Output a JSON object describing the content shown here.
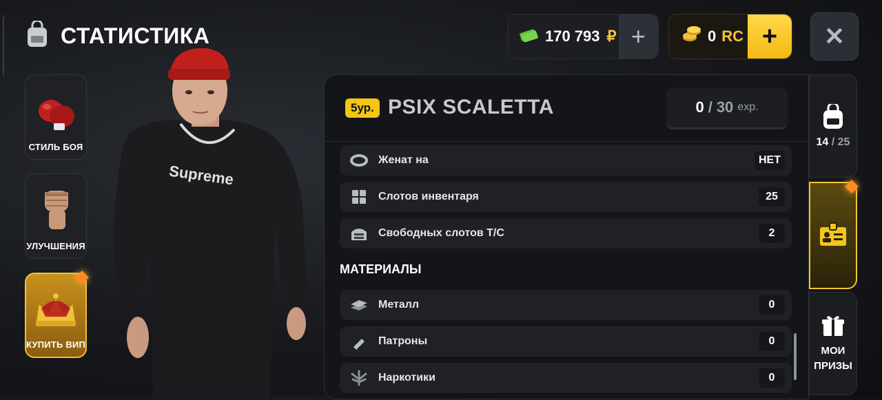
{
  "header": {
    "title": "СТАТИСТИКА"
  },
  "currency": {
    "money": {
      "value": "170 793",
      "symbol": "₽",
      "plus": "+"
    },
    "rc": {
      "value": "0",
      "unit": "RC",
      "plus": "+"
    },
    "close": "✕"
  },
  "left_menu": [
    {
      "label": "СТИЛЬ БОЯ",
      "icon": "boxing-gloves-icon"
    },
    {
      "label": "УЛУЧШЕНИЯ",
      "icon": "fist-icon"
    },
    {
      "label": "КУПИТЬ ВИП",
      "icon": "crown-icon"
    }
  ],
  "character": {
    "shirt_text": "Supreme"
  },
  "player": {
    "level_badge": "5ур.",
    "name": "PSIX SCALETTA",
    "exp": {
      "current": "0",
      "sep": "/",
      "max": "30",
      "unit": "exp."
    }
  },
  "stats": [
    {
      "label": "Женат на",
      "value": "НЕТ",
      "icon": "ring-icon"
    },
    {
      "label": "Слотов инвентаря",
      "value": "25",
      "icon": "grid-icon"
    },
    {
      "label": "Свободных слотов Т/С",
      "value": "2",
      "icon": "garage-icon"
    }
  ],
  "materials": {
    "title": "МАТЕРИАЛЫ",
    "items": [
      {
        "label": "Металл",
        "value": "0",
        "icon": "metal-icon"
      },
      {
        "label": "Патроны",
        "value": "0",
        "icon": "bullet-icon"
      },
      {
        "label": "Наркотики",
        "value": "0",
        "icon": "leaf-icon"
      }
    ]
  },
  "right_tabs": {
    "backpack": {
      "current": "14",
      "sep": " / ",
      "max": "25"
    },
    "prizes": {
      "line1": "МОИ",
      "line2": "ПРИЗЫ"
    }
  },
  "colors": {
    "accent": "#f5c518",
    "vip": "#c8911c",
    "diamond": "#ff8a1e"
  }
}
